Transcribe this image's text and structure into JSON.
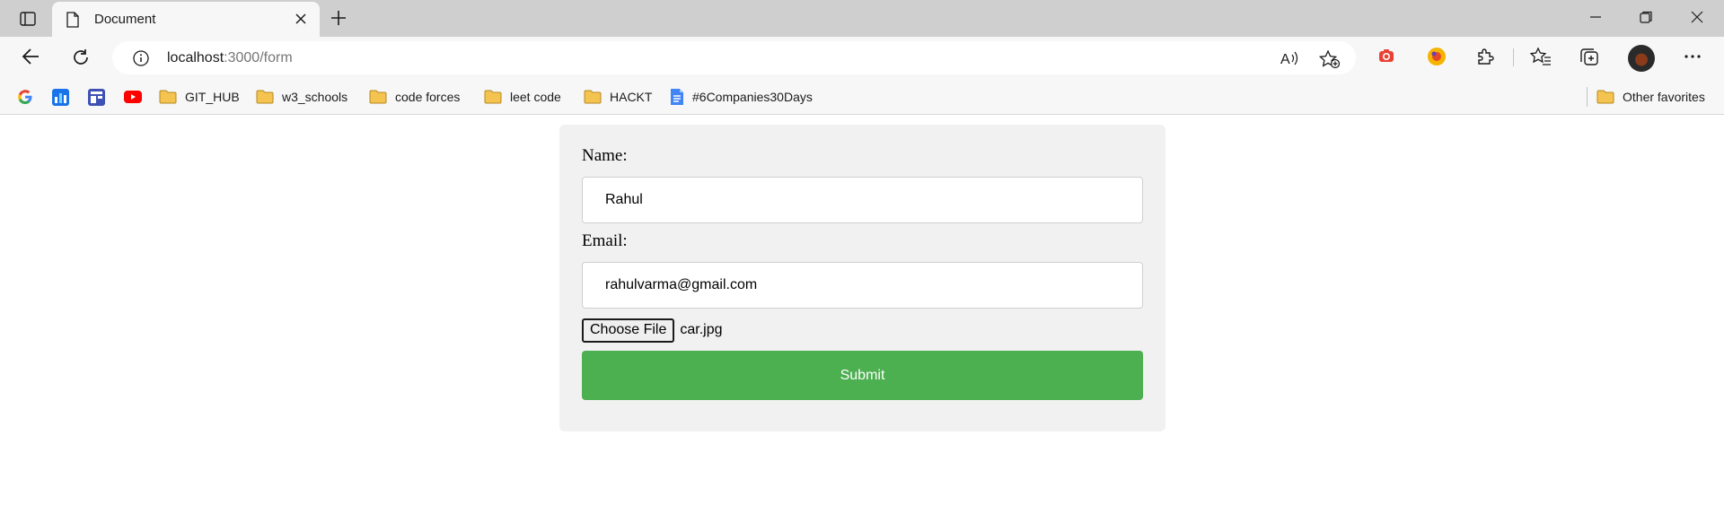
{
  "browser": {
    "tab": {
      "title": "Document"
    },
    "address": {
      "host": "localhost",
      "path": ":3000/form"
    },
    "bookmarks": [
      {
        "label": "",
        "icon": "google-icon"
      },
      {
        "label": "",
        "icon": "chart-app-icon"
      },
      {
        "label": "",
        "icon": "layout-app-icon"
      },
      {
        "label": "",
        "icon": "youtube-icon"
      },
      {
        "label": "GIT_HUB",
        "icon": "folder-icon"
      },
      {
        "label": "w3_schools",
        "icon": "folder-icon"
      },
      {
        "label": "code forces",
        "icon": "folder-icon"
      },
      {
        "label": "leet code",
        "icon": "folder-icon"
      },
      {
        "label": "HACKT",
        "icon": "folder-icon"
      },
      {
        "label": "#6Companies30Days",
        "icon": "docs-icon"
      }
    ],
    "other_favorites": "Other favorites"
  },
  "form": {
    "name_label": "Name:",
    "name_value": "Rahul",
    "email_label": "Email:",
    "email_value": "rahulvarma@gmail.com",
    "file_button": "Choose File",
    "file_name": "car.jpg",
    "submit_label": "Submit"
  },
  "colors": {
    "submit": "#4caf50",
    "card": "#f1f1f1",
    "folder": "#f5c350"
  }
}
